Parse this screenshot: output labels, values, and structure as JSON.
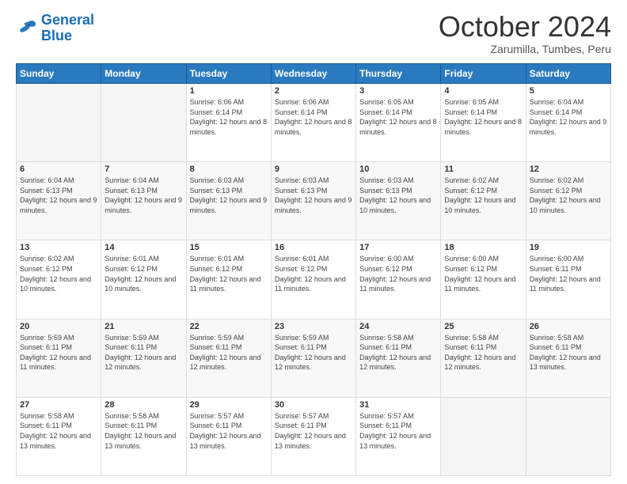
{
  "logo": {
    "line1": "General",
    "line2": "Blue"
  },
  "title": "October 2024",
  "location": "Zarumilla, Tumbes, Peru",
  "days_header": [
    "Sunday",
    "Monday",
    "Tuesday",
    "Wednesday",
    "Thursday",
    "Friday",
    "Saturday"
  ],
  "weeks": [
    [
      null,
      null,
      {
        "day": 1,
        "sunrise": "6:06 AM",
        "sunset": "6:14 PM",
        "daylight": "12 hours and 8 minutes."
      },
      {
        "day": 2,
        "sunrise": "6:06 AM",
        "sunset": "6:14 PM",
        "daylight": "12 hours and 8 minutes."
      },
      {
        "day": 3,
        "sunrise": "6:05 AM",
        "sunset": "6:14 PM",
        "daylight": "12 hours and 8 minutes."
      },
      {
        "day": 4,
        "sunrise": "6:05 AM",
        "sunset": "6:14 PM",
        "daylight": "12 hours and 8 minutes."
      },
      {
        "day": 5,
        "sunrise": "6:04 AM",
        "sunset": "6:14 PM",
        "daylight": "12 hours and 9 minutes."
      }
    ],
    [
      {
        "day": 6,
        "sunrise": "6:04 AM",
        "sunset": "6:13 PM",
        "daylight": "12 hours and 9 minutes."
      },
      {
        "day": 7,
        "sunrise": "6:04 AM",
        "sunset": "6:13 PM",
        "daylight": "12 hours and 9 minutes."
      },
      {
        "day": 8,
        "sunrise": "6:03 AM",
        "sunset": "6:13 PM",
        "daylight": "12 hours and 9 minutes."
      },
      {
        "day": 9,
        "sunrise": "6:03 AM",
        "sunset": "6:13 PM",
        "daylight": "12 hours and 9 minutes."
      },
      {
        "day": 10,
        "sunrise": "6:03 AM",
        "sunset": "6:13 PM",
        "daylight": "12 hours and 10 minutes."
      },
      {
        "day": 11,
        "sunrise": "6:02 AM",
        "sunset": "6:12 PM",
        "daylight": "12 hours and 10 minutes."
      },
      {
        "day": 12,
        "sunrise": "6:02 AM",
        "sunset": "6:12 PM",
        "daylight": "12 hours and 10 minutes."
      }
    ],
    [
      {
        "day": 13,
        "sunrise": "6:02 AM",
        "sunset": "6:12 PM",
        "daylight": "12 hours and 10 minutes."
      },
      {
        "day": 14,
        "sunrise": "6:01 AM",
        "sunset": "6:12 PM",
        "daylight": "12 hours and 10 minutes."
      },
      {
        "day": 15,
        "sunrise": "6:01 AM",
        "sunset": "6:12 PM",
        "daylight": "12 hours and 11 minutes."
      },
      {
        "day": 16,
        "sunrise": "6:01 AM",
        "sunset": "6:12 PM",
        "daylight": "12 hours and 11 minutes."
      },
      {
        "day": 17,
        "sunrise": "6:00 AM",
        "sunset": "6:12 PM",
        "daylight": "12 hours and 11 minutes."
      },
      {
        "day": 18,
        "sunrise": "6:00 AM",
        "sunset": "6:12 PM",
        "daylight": "12 hours and 11 minutes."
      },
      {
        "day": 19,
        "sunrise": "6:00 AM",
        "sunset": "6:11 PM",
        "daylight": "12 hours and 11 minutes."
      }
    ],
    [
      {
        "day": 20,
        "sunrise": "5:59 AM",
        "sunset": "6:11 PM",
        "daylight": "12 hours and 11 minutes."
      },
      {
        "day": 21,
        "sunrise": "5:59 AM",
        "sunset": "6:11 PM",
        "daylight": "12 hours and 12 minutes."
      },
      {
        "day": 22,
        "sunrise": "5:59 AM",
        "sunset": "6:11 PM",
        "daylight": "12 hours and 12 minutes."
      },
      {
        "day": 23,
        "sunrise": "5:59 AM",
        "sunset": "6:11 PM",
        "daylight": "12 hours and 12 minutes."
      },
      {
        "day": 24,
        "sunrise": "5:58 AM",
        "sunset": "6:11 PM",
        "daylight": "12 hours and 12 minutes."
      },
      {
        "day": 25,
        "sunrise": "5:58 AM",
        "sunset": "6:11 PM",
        "daylight": "12 hours and 12 minutes."
      },
      {
        "day": 26,
        "sunrise": "5:58 AM",
        "sunset": "6:11 PM",
        "daylight": "12 hours and 13 minutes."
      }
    ],
    [
      {
        "day": 27,
        "sunrise": "5:58 AM",
        "sunset": "6:11 PM",
        "daylight": "12 hours and 13 minutes."
      },
      {
        "day": 28,
        "sunrise": "5:58 AM",
        "sunset": "6:11 PM",
        "daylight": "12 hours and 13 minutes."
      },
      {
        "day": 29,
        "sunrise": "5:57 AM",
        "sunset": "6:11 PM",
        "daylight": "12 hours and 13 minutes."
      },
      {
        "day": 30,
        "sunrise": "5:57 AM",
        "sunset": "6:11 PM",
        "daylight": "12 hours and 13 minutes."
      },
      {
        "day": 31,
        "sunrise": "5:57 AM",
        "sunset": "6:11 PM",
        "daylight": "12 hours and 13 minutes."
      },
      null,
      null
    ]
  ],
  "labels": {
    "sunrise": "Sunrise:",
    "sunset": "Sunset:",
    "daylight": "Daylight:"
  }
}
